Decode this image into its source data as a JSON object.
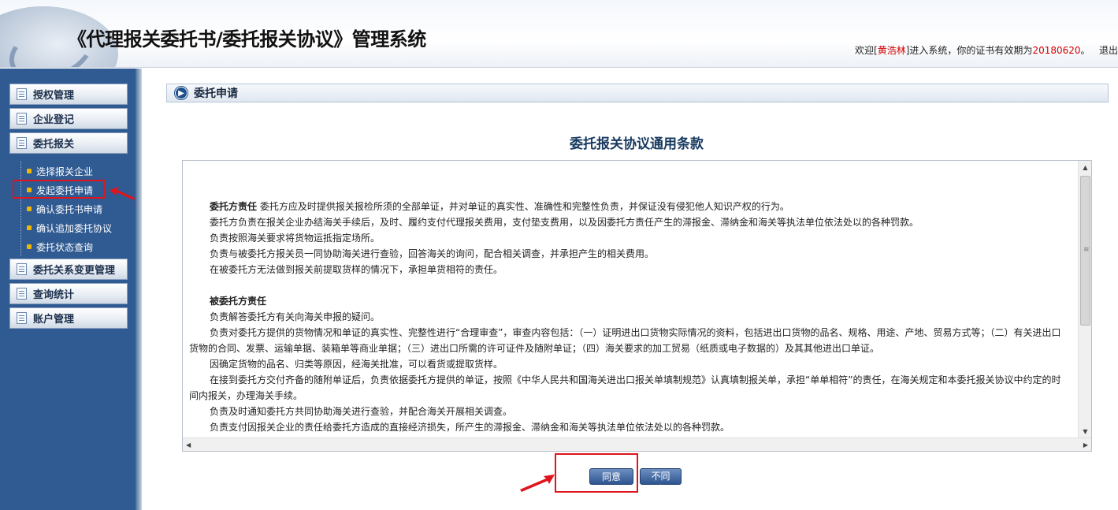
{
  "header": {
    "title": "《代理报关委托书/委托报关协议》管理系统",
    "welcome_prefix": "欢迎[",
    "user_name": "黄浩林",
    "welcome_mid": "]进入系统，你的证书有效期为",
    "cert_expiry": "20180620",
    "welcome_suffix": "。",
    "logout_partial": "退出"
  },
  "sidebar": {
    "sections": [
      {
        "label": "授权管理"
      },
      {
        "label": "企业登记"
      },
      {
        "label": "委托报关"
      },
      {
        "label": "委托关系变更管理"
      },
      {
        "label": "查询统计"
      },
      {
        "label": "账户管理"
      }
    ],
    "submenu": [
      {
        "label": "选择报关企业"
      },
      {
        "label": "发起委托申请"
      },
      {
        "label": "确认委托书申请"
      },
      {
        "label": "确认追加委托协议"
      },
      {
        "label": "委托状态查询"
      }
    ]
  },
  "breadcrumb": {
    "title": "委托申请"
  },
  "document": {
    "title": "委托报关协议通用条款",
    "principal_heading": "委托方责任",
    "principal_lines": [
      "委托方应及时提供报关报检所须的全部单证，并对单证的真实性、准确性和完整性负责，并保证没有侵犯他人知识产权的行为。",
      "委托方负责在报关企业办结海关手续后，及时、履约支付代理报关费用，支付垫支费用，以及因委托方责任产生的滞报金、滞纳金和海关等执法单位依法处以的各种罚款。",
      "负责按照海关要求将货物运抵指定场所。",
      "负责与被委托方报关员一同协助海关进行查验，回答海关的询问，配合相关调查，并承担产生的相关费用。",
      "在被委托方无法做到报关前提取货样的情况下，承担单货相符的责任。"
    ],
    "agent_heading": "被委托方责任",
    "agent_lines": [
      "负责解答委托方有关向海关申报的疑问。",
      "负责对委托方提供的货物情况和单证的真实性、完整性进行“合理审查”，审查内容包括：（一）证明进出口货物实际情况的资料，包括进出口货物的品名、规格、用途、产地、贸易方式等；（二）有关进出口货物的合同、发票、运输单据、装箱单等商业单据；（三）进出口所需的许可证件及随附单证；（四）海关要求的加工贸易（纸质或电子数据的）及其其他进出口单证。",
      "因确定货物的品名、归类等原因，经海关批准，可以看货或提取货样。",
      "在接到委托方交付齐备的随附单证后，负责依据委托方提供的单证，按照《中华人民共和国海关进出口报关单填制规范》认真填制报关单，承担“单单相符”的责任，在海关规定和本委托报关协议中约定的时间内报关，办理海关手续。",
      "负责及时通知委托方共同协助海关进行查验，并配合海关开展相关调查。",
      "负责支付因报关企业的责任给委托方造成的直接经济损失，所产生的滞报金、滞纳金和海关等执法单位依法处以的各种罚款。"
    ]
  },
  "buttons": {
    "agree": "同意",
    "disagree": "不同意"
  },
  "colors": {
    "sidebar_bg": "#2f5a92",
    "highlight": "#e0141d",
    "button": "#2e5591"
  }
}
